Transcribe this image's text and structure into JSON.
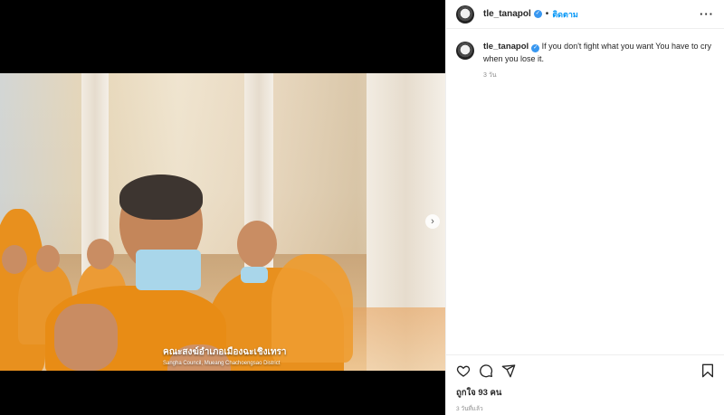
{
  "post": {
    "username": "tle_tanapol",
    "follow_label": "ติดตาม",
    "more_label": "···",
    "dot": "•"
  },
  "image": {
    "caption_th": "คณะสงฆ์อำเภอเมืองฉะเชิงเทรา",
    "caption_en": "Sangha Council, Mueang Chachoengsao District",
    "next_label": "›"
  },
  "comment": {
    "username": "tle_tanapol",
    "text": "If you don't fight what you want You have to cry when you lose it.",
    "time": "3 วัน"
  },
  "footer": {
    "likes": "ถูกใจ 93 คน",
    "posted": "3 วันที่แล้ว"
  },
  "icons": {
    "verified": "verified-badge-icon",
    "like": "heart-icon",
    "comment": "comment-bubble-icon",
    "share": "paper-plane-icon",
    "save": "bookmark-icon"
  }
}
